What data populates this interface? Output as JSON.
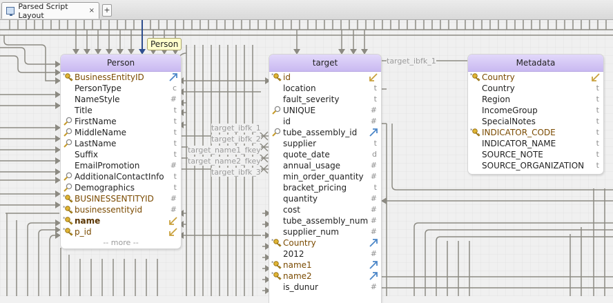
{
  "window": {
    "tab_label": "Parsed Script Layout",
    "tab_close": "×",
    "new_tab": "+"
  },
  "tooltip": "Person",
  "tables": {
    "person": {
      "title": "Person",
      "more": "-- more --",
      "rows": [
        {
          "name": "BusinessEntityID",
          "type": "",
          "key": "pk",
          "type_icon": "arrow-up-right"
        },
        {
          "name": "PersonType",
          "type": "c"
        },
        {
          "name": "NameStyle",
          "type": "#"
        },
        {
          "name": "Title",
          "type": "t"
        },
        {
          "name": "FirstName",
          "type": "t",
          "key": "search"
        },
        {
          "name": "MiddleName",
          "type": "t",
          "key": "search"
        },
        {
          "name": "LastName",
          "type": "t",
          "key": "search"
        },
        {
          "name": "Suffix",
          "type": "t"
        },
        {
          "name": "EmailPromotion",
          "type": "#"
        },
        {
          "name": "AdditionalContactInfo",
          "type": "t",
          "key": "search"
        },
        {
          "name": "Demographics",
          "type": "t",
          "key": "search"
        },
        {
          "name": "BUSINESSENTITYID",
          "type": "#",
          "key": "pk"
        },
        {
          "name": "businessentityid",
          "type": "#",
          "key": "pk"
        },
        {
          "name": "name",
          "type": "",
          "key": "pk",
          "type_icon": "arrow-down-left"
        },
        {
          "name": "p_id",
          "type": "",
          "key": "pk",
          "type_icon": "arrow-down-left"
        }
      ]
    },
    "target": {
      "title": "target",
      "rows": [
        {
          "name": "id",
          "type": "",
          "key": "pk",
          "type_icon": "arrow-down-left"
        },
        {
          "name": "location",
          "type": "t"
        },
        {
          "name": "fault_severity",
          "type": "t"
        },
        {
          "name": "UNIQUE",
          "type": "#",
          "key": "search"
        },
        {
          "name": "id",
          "type": "#"
        },
        {
          "name": "tube_assembly_id",
          "type": "",
          "key": "search",
          "type_icon": "arrow-up-right"
        },
        {
          "name": "supplier",
          "type": "t"
        },
        {
          "name": "quote_date",
          "type": "d"
        },
        {
          "name": "annual_usage",
          "type": "#"
        },
        {
          "name": "min_order_quantity",
          "type": "#"
        },
        {
          "name": "bracket_pricing",
          "type": "t"
        },
        {
          "name": "quantity",
          "type": "#"
        },
        {
          "name": "cost",
          "type": "#"
        },
        {
          "name": "tube_assembly_num",
          "type": "#"
        },
        {
          "name": "supplier_num",
          "type": "#"
        },
        {
          "name": "Country",
          "type": "",
          "key": "pk",
          "type_icon": "arrow-up-right"
        },
        {
          "name": "2012",
          "type": "#"
        },
        {
          "name": "name1",
          "type": "",
          "key": "pk",
          "type_icon": "arrow-up-right"
        },
        {
          "name": "name2",
          "type": "",
          "key": "pk",
          "type_icon": "arrow-up-right"
        },
        {
          "name": "is_dunur",
          "type": "#"
        }
      ]
    },
    "metadata": {
      "title": "Metadata",
      "rows": [
        {
          "name": "Country",
          "type": "",
          "key": "pk",
          "type_icon": "arrow-down-left"
        },
        {
          "name": "Country",
          "type": "t"
        },
        {
          "name": "Region",
          "type": "t"
        },
        {
          "name": "IncomeGroup",
          "type": "t"
        },
        {
          "name": "SpecialNotes",
          "type": "t"
        },
        {
          "name": "INDICATOR_CODE",
          "type": "t",
          "key": "pk"
        },
        {
          "name": "INDICATOR_NAME",
          "type": "t"
        },
        {
          "name": "SOURCE_NOTE",
          "type": "t"
        },
        {
          "name": "SOURCE_ORGANIZATION",
          "type": "t"
        }
      ]
    }
  },
  "relations": [
    "target_ibfk_1",
    "target_ibfk_1",
    "target_ibfk_2",
    "target_name1_fkey",
    "target_name2_fkey",
    "target_ibfk_3"
  ],
  "colors": {
    "header_top": "#e2d8fa",
    "header_bottom": "#c9b9f1",
    "line": "#8c8a82",
    "selected_line": "#2f4f8f",
    "key_gold": "#d2a52a",
    "fk_text": "#7a4a00",
    "tooltip_bg": "#ffffcc"
  }
}
